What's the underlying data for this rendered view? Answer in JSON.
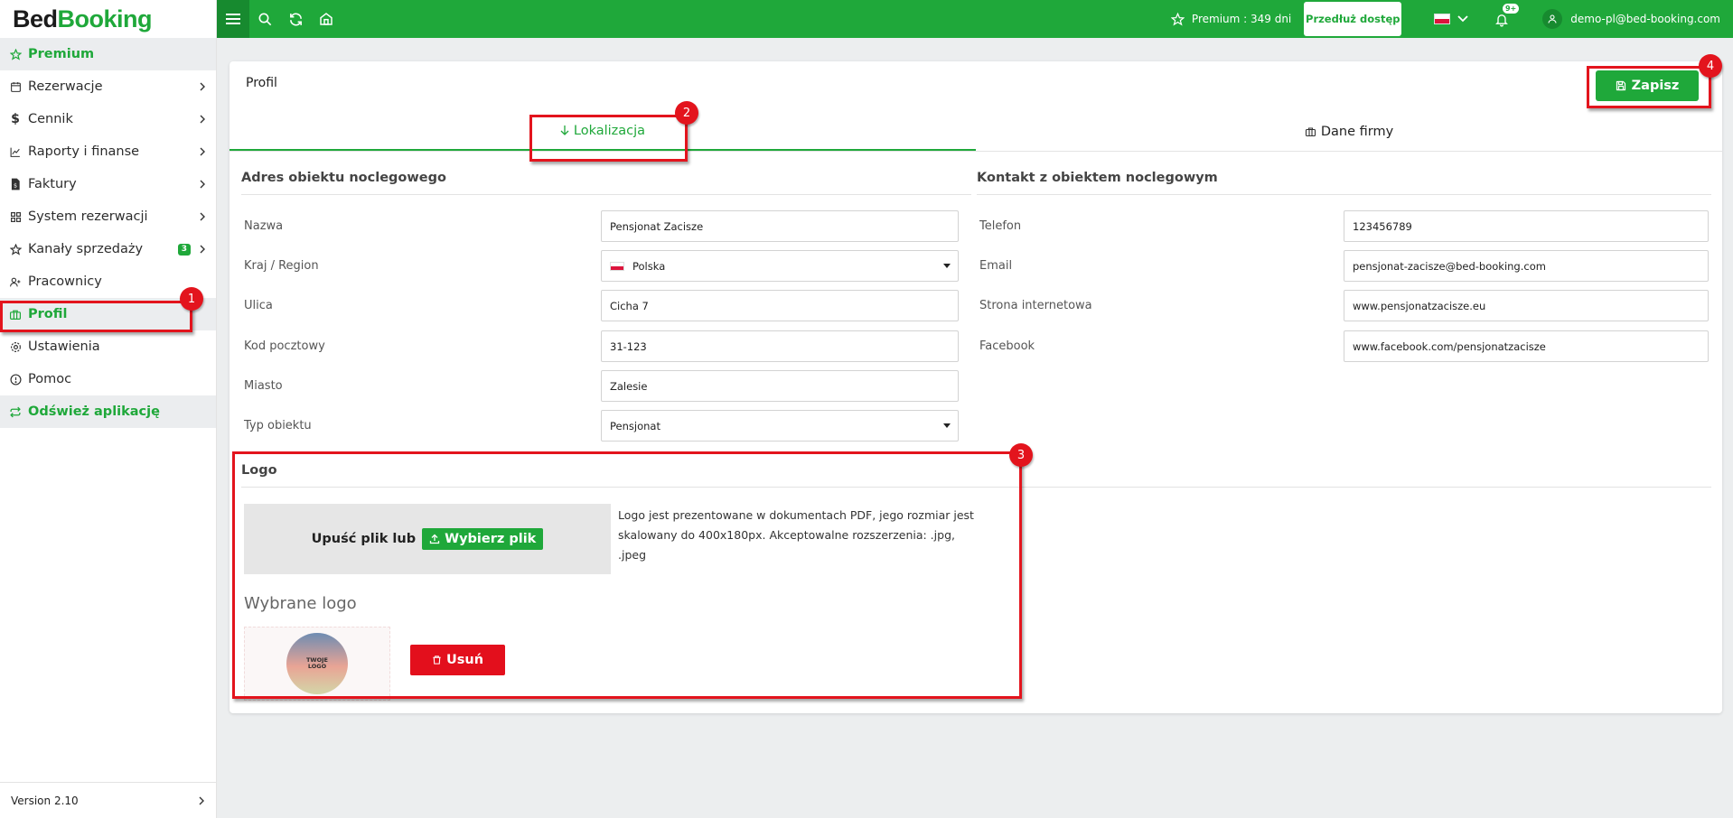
{
  "app": {
    "logo_part1": "Bed",
    "logo_part2": "Booking",
    "accent_color": "#1fa83a"
  },
  "sidebar": {
    "items": [
      {
        "label": "Premium",
        "icon": "star-icon"
      },
      {
        "label": "Rezerwacje",
        "icon": "calendar-icon"
      },
      {
        "label": "Cennik",
        "icon": "dollar-icon"
      },
      {
        "label": "Raporty i finanse",
        "icon": "chart-icon"
      },
      {
        "label": "Faktury",
        "icon": "invoice-icon"
      },
      {
        "label": "System rezerwacji",
        "icon": "grid-icon"
      },
      {
        "label": "Kanały sprzedaży",
        "icon": "star-icon",
        "badge": "3"
      },
      {
        "label": "Pracownicy",
        "icon": "user-add-icon"
      },
      {
        "label": "Profil",
        "icon": "briefcase-icon"
      },
      {
        "label": "Ustawienia",
        "icon": "gear-icon"
      },
      {
        "label": "Pomoc",
        "icon": "info-icon"
      },
      {
        "label": "Odśwież aplikację",
        "icon": "refresh-icon"
      }
    ],
    "version": "Version 2.10"
  },
  "topbar": {
    "premium_status": "Premium : 349 dni",
    "extend_button": "Przedłuż dostęp",
    "language": "pl",
    "notification_badge": "9+",
    "user_email": "demo-pl@bed-booking.com"
  },
  "page": {
    "title": "Profil",
    "save_button": "Zapisz",
    "tabs": [
      {
        "label": "Lokalizacja",
        "icon": "arrow-down-icon",
        "active": true
      },
      {
        "label": "Dane firmy",
        "icon": "briefcase-icon",
        "active": false
      }
    ]
  },
  "address": {
    "title": "Adres obiektu noclegowego",
    "fields": [
      {
        "label": "Nazwa",
        "value": "Pensjonat Zacisze"
      },
      {
        "label": "Kraj / Region",
        "value": "Polska"
      },
      {
        "label": "Ulica",
        "value": "Cicha 7"
      },
      {
        "label": "Kod pocztowy",
        "value": "31-123"
      },
      {
        "label": "Miasto",
        "value": "Zalesie"
      },
      {
        "label": "Typ obiektu",
        "value": "Pensjonat"
      }
    ]
  },
  "contact": {
    "title": "Kontakt z obiektem noclegowym",
    "fields": [
      {
        "label": "Telefon",
        "value": "123456789"
      },
      {
        "label": "Email",
        "value": "pensjonat-zacisze@bed-booking.com"
      },
      {
        "label": "Strona internetowa",
        "value": "www.pensjonatzacisze.eu"
      },
      {
        "label": "Facebook",
        "value": "www.facebook.com/pensjonatzacisze"
      }
    ]
  },
  "logo_section": {
    "title": "Logo",
    "drop_text": "Upuść plik lub",
    "choose_button": "Wybierz plik",
    "description": "Logo jest prezentowane w dokumentach PDF, jego rozmiar jest skalowany do 400x180px. Akceptowalne rozszerzenia: .jpg, .jpeg",
    "selected_title": "Wybrane logo",
    "logo_text_line1": "TWOJE",
    "logo_text_line2": "LOGO",
    "delete_button": "Usuń"
  },
  "callouts": {
    "c1": "1",
    "c2": "2",
    "c3": "3",
    "c4": "4",
    "color": "#e3141d"
  }
}
